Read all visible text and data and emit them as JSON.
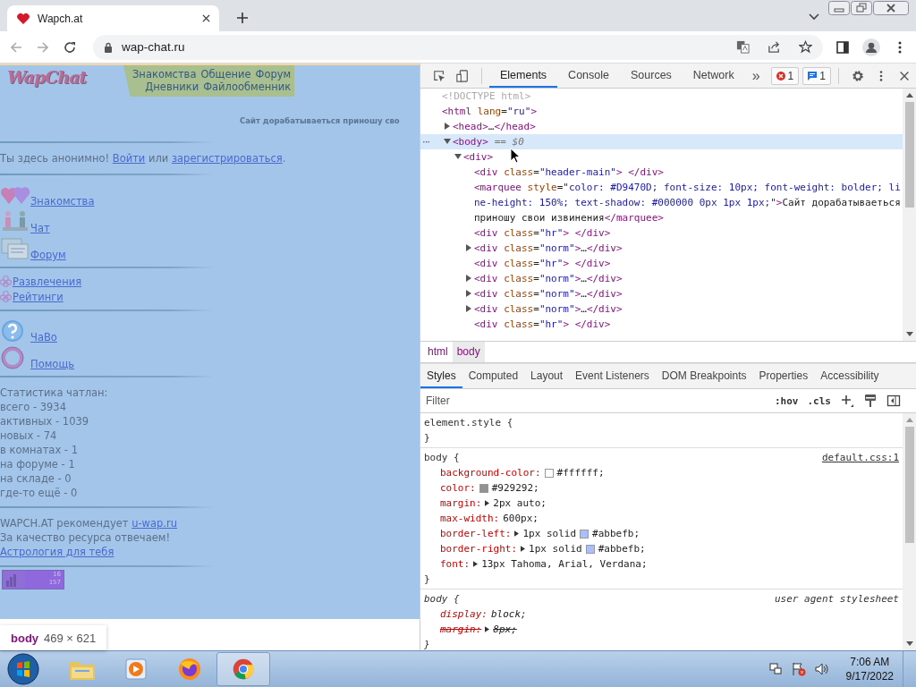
{
  "browser": {
    "tab_title": "Wapch.at",
    "address": "wap-chat.ru"
  },
  "page": {
    "logo": "WapChat",
    "nav_rows": [
      [
        "Знакомства",
        "Общение",
        "Форум"
      ],
      [
        "Дневники",
        "Файлообменник"
      ]
    ],
    "marquee": "Сайт дорабатываеться приношу сво",
    "notice": [
      {
        "text": "Ты здесь анонимно! ",
        "link": false
      },
      {
        "text": "Войти",
        "link": true
      },
      {
        "text": " или ",
        "link": false
      },
      {
        "text": "зарегистрироваться",
        "link": true
      },
      {
        "text": ".",
        "link": false
      }
    ],
    "sections": [
      {
        "kind": "large",
        "items": [
          "Знакомства",
          "Чат",
          "Форум"
        ]
      },
      {
        "kind": "small",
        "items": [
          "Развлечения",
          "Рейтинги"
        ]
      },
      {
        "kind": "large",
        "items": [
          "ЧаВо",
          "Помощь"
        ]
      }
    ],
    "stats": [
      "Статистика чатлан:",
      "всего - 3934",
      "активных - 1039",
      "новых - 74",
      "в комнатах - 1",
      "на форуме - 1",
      "на складе - 0",
      "где-то ещё - 0"
    ],
    "footer": [
      [
        {
          "text": "WAPCH.AT рекомендует ",
          "link": false
        },
        {
          "text": "u-wap.ru",
          "link": true
        }
      ],
      [
        {
          "text": "За качество ресурса отвечаем!",
          "link": false
        }
      ],
      [
        {
          "text": "Астрология для тебя",
          "link": true
        }
      ]
    ],
    "counter": [
      "16",
      "157"
    ]
  },
  "tooltip": {
    "tag": "body",
    "size": "469 × 621"
  },
  "devtools": {
    "tabs": [
      {
        "label": "Elements",
        "selected": true
      },
      {
        "label": "Console",
        "selected": false
      },
      {
        "label": "Sources",
        "selected": false
      },
      {
        "label": "Network",
        "selected": false
      }
    ],
    "more": "»",
    "errors": "1",
    "messages": "1",
    "node_menu": "···",
    "dom": [
      {
        "kind": "doctype",
        "text": "<!DOCTYPE html>",
        "selected": false
      },
      {
        "kind": "element",
        "text": "<html lang=\"ru\">",
        "selected": false,
        "children": [
          {
            "kind": "element",
            "text": "<head>…</head>",
            "expanded": false,
            "selected": false
          },
          {
            "kind": "element",
            "text": "<body>",
            "suffix": "== $0",
            "expanded": true,
            "selected": true,
            "children": [
              {
                "kind": "element",
                "text": "<div>",
                "expanded": true,
                "selected": false,
                "children": [
                  {
                    "kind": "element",
                    "text": "<div class=\"header-main\"> </div>",
                    "selected": false
                  },
                  {
                    "kind": "element",
                    "text": "<marquee style=\"color: #D9470D; font-size: 10px; font-weight: bolder; line-height: 150%; text-shadow: #000000 0px 1px 1px;\">Сайт дорабатываеться приношу свои извинения</marquee>",
                    "selected": false
                  },
                  {
                    "kind": "element",
                    "text": "<div class=\"hr\"> </div>",
                    "selected": false
                  },
                  {
                    "kind": "element",
                    "text": "<div class=\"norm\">…</div>",
                    "expanded": false,
                    "selected": false
                  },
                  {
                    "kind": "element",
                    "text": "<div class=\"hr\"> </div>",
                    "selected": false
                  },
                  {
                    "kind": "element",
                    "text": "<div class=\"norm\">…</div>",
                    "expanded": false,
                    "selected": false
                  },
                  {
                    "kind": "element",
                    "text": "<div class=\"norm\">…</div>",
                    "expanded": false,
                    "selected": false
                  },
                  {
                    "kind": "element",
                    "text": "<div class=\"norm\">…</div>",
                    "expanded": false,
                    "selected": false
                  },
                  {
                    "kind": "element",
                    "text": "<div class=\"hr\"> </div>",
                    "selected": false
                  }
                ]
              }
            ]
          }
        ]
      }
    ],
    "breadcrumbs": [
      {
        "label": "html",
        "selected": false
      },
      {
        "label": "body",
        "selected": true
      }
    ],
    "style_tabs": [
      {
        "label": "Styles",
        "selected": true
      },
      {
        "label": "Computed",
        "selected": false
      },
      {
        "label": "Layout",
        "selected": false
      },
      {
        "label": "Event Listeners",
        "selected": false
      },
      {
        "label": "DOM Breakpoints",
        "selected": false
      },
      {
        "label": "Properties",
        "selected": false
      },
      {
        "label": "Accessibility",
        "selected": false
      }
    ],
    "filter_placeholder": "Filter",
    "hov": ":hov",
    "cls": ".cls",
    "rules": [
      {
        "kind": "inline",
        "selector": "element.style {",
        "close": "}"
      },
      {
        "kind": "author",
        "selector": "body {",
        "source": "default.css:1",
        "close": "}",
        "declarations": [
          {
            "property": "background-color:",
            "value": "#ffffff;",
            "color": "#ffffff",
            "expandable": false,
            "overridden": false
          },
          {
            "property": "color:",
            "value": "#929292;",
            "color": "#929292",
            "expandable": false,
            "overridden": false
          },
          {
            "property": "margin:",
            "value": "2px auto;",
            "expandable": true,
            "overridden": false
          },
          {
            "property": "max-width:",
            "value": "600px;",
            "expandable": false,
            "overridden": false
          },
          {
            "property": "border-left:",
            "value": "1px solid",
            "value2": "#abbefb;",
            "color": "#abbefb",
            "expandable": true,
            "overridden": false
          },
          {
            "property": "border-right:",
            "value": "1px solid",
            "value2": "#abbefb;",
            "color": "#abbefb",
            "expandable": true,
            "overridden": false
          },
          {
            "property": "font:",
            "value": "13px Tahoma, Arial, Verdana;",
            "expandable": true,
            "overridden": false
          }
        ]
      },
      {
        "kind": "user_agent",
        "selector": "body {",
        "source": "user agent stylesheet",
        "close": "}",
        "declarations": [
          {
            "property": "display:",
            "value": "block;",
            "expandable": false,
            "overridden": false
          },
          {
            "property": "margin:",
            "value": "8px;",
            "expandable": true,
            "overridden": true
          }
        ]
      }
    ]
  },
  "taskbar": {
    "time": "7:06 AM",
    "date": "9/17/2022"
  }
}
